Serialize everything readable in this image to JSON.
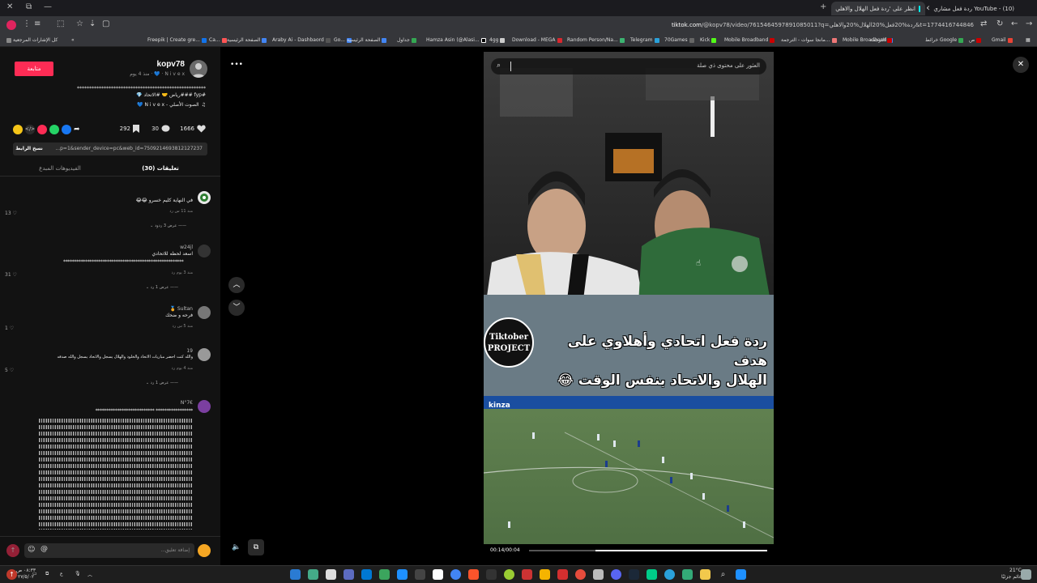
{
  "browser": {
    "tabs": [
      {
        "label": "YouTube - (10) ردة فعل مشاري",
        "active": false
      },
      {
        "label": "انظر على 'ردة فعل الهلال والاهلي",
        "active": true
      }
    ],
    "address": {
      "domain": "tiktok.com",
      "path": "/@kopv78/video/7615464597891085011?q=ردة%20فعل%20الهلال%20والاهلي&t=1774416744846"
    },
    "bookmarks": [
      "Gmail",
      "ص",
      "خرائط Google",
      "الترجمة",
      "Mobile Broadband",
      "مانجا سوات - الترجمة...",
      "Mobile Broadband",
      "Kick",
      "70Games",
      "Telegram",
      "Random Person/Na...",
      "Download - MEGA",
      "4gg",
      "Hamza Asin (@Alasi...",
      "جداول",
      "الصفحة الرئيسية",
      "Go...",
      "Araby Ai - Dashbaord",
      "الصفحة الرئيسية",
      "Ca...",
      "Freepik | Create gre..."
    ],
    "bookmarks_all": "كل الإشارات المرجعية"
  },
  "post": {
    "username": "kopv78",
    "display": "N i v e x · 💙 · منذ 4 يوم",
    "follow_label": "متابعة",
    "caption_line1": "*****************************************************",
    "caption_line2": "#fyp ###رياض 🤝 #الاتحاد 💎",
    "sound": "الصوت الأصلي - N i v e x 💙",
    "likes": "1666",
    "comments": "30",
    "saves": "292",
    "link": "...p=1&sender_device=pc&web_id=7509214693812127237",
    "copy_label": "نسخ الرابط",
    "tab_comments": "تعليقات (30)",
    "tab_creator": "الفيديوهات المبدع"
  },
  "comments": [
    {
      "name": "",
      "text": "في النهاية كليم خسرو 😂😂",
      "meta": "منذ 11 س  رد",
      "likes": "13",
      "replies": "عرض 3 ردود"
    },
    {
      "name": "w24jl",
      "text": "اسعد لحظه للاتحادي",
      "extra": "*******************************************************",
      "meta": "منذ 3 يوم  رد",
      "likes": "31",
      "replies": "عرض 1 رد"
    },
    {
      "name": "Sultan 🏅",
      "text": "فرحه و ضحك",
      "meta": "منذ 5 س  رد",
      "likes": "1",
      "replies": ""
    },
    {
      "name": "19",
      "text": "والله كنت احضر مباريات الاتحاد والخلود والهلال يسجل والاتحاد يسجل والله صدفه",
      "meta": "منذ 4 يوم  رد",
      "likes": "5",
      "replies": "عرض 1 رد"
    },
    {
      "name": "N°7€",
      "text": "*************************** *****************",
      "meta": "",
      "likes": "",
      "replies": ""
    }
  ],
  "comment_placeholder": "إضافة تعليق...",
  "video": {
    "search_placeholder": "العثور على محتوى ذي صلة",
    "caption_line1": "ردة فعل اتحادي وأهلاوي على هدف",
    "caption_line2": "الهلال والاتحاد بنفس الوقت 😂",
    "logo": "Tiktober PROJECT",
    "time": "00:14/00:04",
    "progress": 0.72,
    "banner": "kinza"
  },
  "taskbar": {
    "weather_temp": "21°C",
    "weather_text": "غائم جزئيًا",
    "time": "٠٨:٣٣ ص",
    "date": "٢٧/٥/٠٢",
    "lang": "ع"
  },
  "colors": {
    "accent": "#fe2c55",
    "bg": "#121212"
  }
}
